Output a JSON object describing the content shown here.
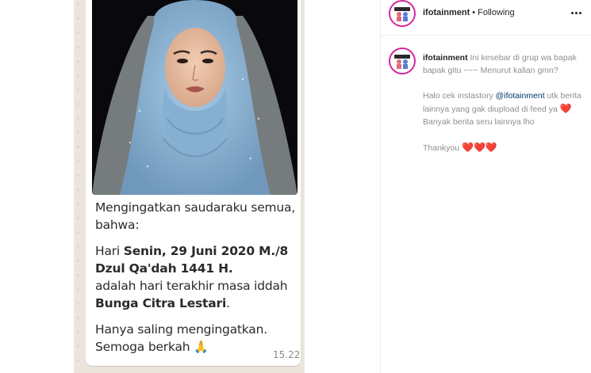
{
  "message": {
    "line1": "Mengingatkan saudaraku semua,",
    "line2": "bahwa:",
    "p2_a": "Hari ",
    "p2_b": "Senin, 29 Juni 2020 M./8",
    "p2_c": "Dzul Qa'dah 1441 H.",
    "p2_d": "adalah hari terakhir masa iddah",
    "p2_e": "Bunga Citra Lestari",
    "p2_f": ".",
    "p3_a": "Hanya saling mengingatkan.",
    "p3_b": "Semoga berkah ",
    "p3_emoji": "🙏",
    "time": "15.22"
  },
  "instagram": {
    "username": "ifotainment",
    "follow_status": "Following",
    "dot": "•",
    "caption": {
      "p1": "Ini kesebar di grup wa bapak bapak gitu ~~~ Menurut kalian gmn?",
      "p2_a": "Halo cek instastory ",
      "p2_mention": "@ifotainment",
      "p2_b": " utk berita lainnya yang gak diupload di feed ya ",
      "p2_heart": "❤️",
      "p2_c": " Banyak berita seru lainnya lho",
      "p3": "Thankyou ",
      "p3_hearts": "❤️❤️❤️"
    },
    "icons": {
      "avatar": "ifotainment-logo-icon",
      "more": "more-options-icon"
    }
  },
  "colors": {
    "whatsapp_bg": "#ece5dd",
    "hijab": "#8fb9d8",
    "story_ring": "#d6249f",
    "heart": "#ed1c24",
    "mention": "#00376b"
  }
}
